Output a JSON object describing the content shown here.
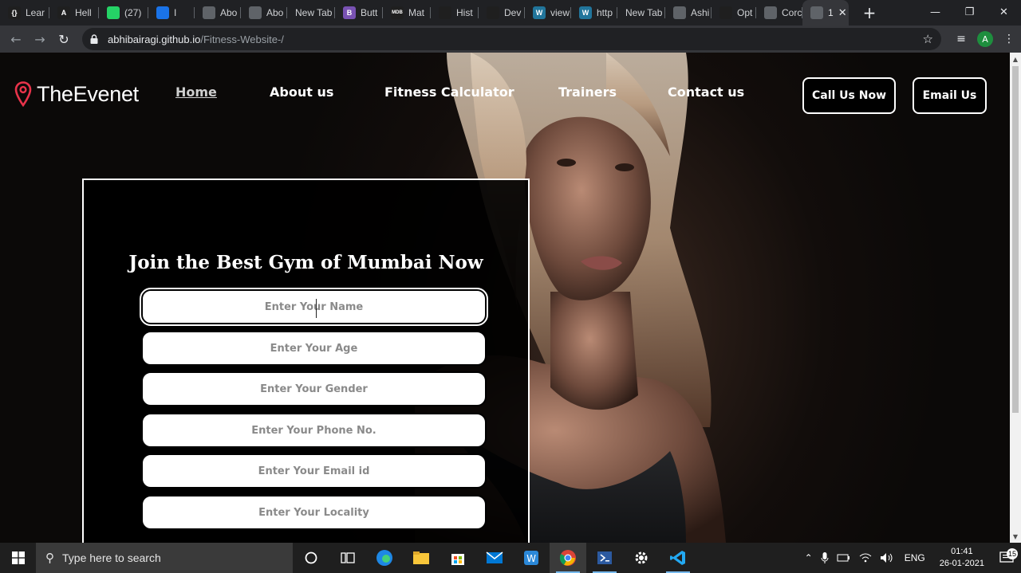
{
  "browser": {
    "tabs": [
      {
        "label": "Lear",
        "fav_color": "#1f1f1f",
        "fav_glyph": "{}",
        "icon": "code-icon"
      },
      {
        "label": "Hell",
        "fav_color": "#1f1f1f",
        "fav_glyph": "A",
        "icon": "a-logo-icon"
      },
      {
        "label": "(27)",
        "fav_color": "#25d366",
        "fav_glyph": "",
        "icon": "whatsapp-icon"
      },
      {
        "label": "I",
        "fav_color": "#1a73e8",
        "fav_glyph": "",
        "icon": "meet-icon"
      },
      {
        "label": "Abo",
        "fav_color": "#5f6368",
        "fav_glyph": "",
        "icon": "globe-icon"
      },
      {
        "label": "Abo",
        "fav_color": "#5f6368",
        "fav_glyph": "",
        "icon": "globe-icon"
      },
      {
        "label": "New Tab",
        "fav_color": "",
        "fav_glyph": "",
        "icon": ""
      },
      {
        "label": "Butt",
        "fav_color": "#7952b3",
        "fav_glyph": "B",
        "icon": "bootstrap-icon"
      },
      {
        "label": "Mat",
        "fav_color": "#1f1f1f",
        "fav_glyph": "MDB",
        "icon": "mdb-icon"
      },
      {
        "label": "Hist",
        "fav_color": "#1f1f1f",
        "fav_glyph": "",
        "icon": "history-icon"
      },
      {
        "label": "Dev",
        "fav_color": "#1f1f1f",
        "fav_glyph": "",
        "icon": "heart-icon"
      },
      {
        "label": "view",
        "fav_color": "#21759b",
        "fav_glyph": "W",
        "icon": "wordpress-icon"
      },
      {
        "label": "http",
        "fav_color": "#21759b",
        "fav_glyph": "W",
        "icon": "wordpress-icon"
      },
      {
        "label": "New Tab",
        "fav_color": "",
        "fav_glyph": "",
        "icon": ""
      },
      {
        "label": "Ashi",
        "fav_color": "#5f6368",
        "fav_glyph": "",
        "icon": "globe-icon"
      },
      {
        "label": "Opt",
        "fav_color": "#1f1f1f",
        "fav_glyph": "",
        "icon": "github-icon"
      },
      {
        "label": "Corc",
        "fav_color": "#5f6368",
        "fav_glyph": "",
        "icon": "globe-icon"
      },
      {
        "label": "1",
        "fav_color": "#5f6368",
        "fav_glyph": "",
        "icon": "globe-icon",
        "active": true
      }
    ],
    "url_host": "abhibairagi.github.io",
    "url_path": "/Fitness-Website-/",
    "profile_initial": "A"
  },
  "site": {
    "brand": "TheEvenet",
    "nav": {
      "home": "Home",
      "about": "About us",
      "calculator": "Fitness Calculator",
      "trainers": "Trainers",
      "contact": "Contact us"
    },
    "buttons": {
      "call": "Call Us Now",
      "email": "Email Us"
    },
    "accent_color": "#e8334a",
    "form": {
      "title": "Join the Best Gym of Mumbai Now",
      "fields": [
        {
          "placeholder": "Enter Your Name"
        },
        {
          "placeholder": "Enter Your Age"
        },
        {
          "placeholder": "Enter Your Gender"
        },
        {
          "placeholder": "Enter Your Phone No."
        },
        {
          "placeholder": "Enter Your Email id"
        },
        {
          "placeholder": "Enter Your Locality"
        }
      ]
    }
  },
  "taskbar": {
    "search_placeholder": "Type here to search",
    "language": "ENG",
    "time": "01:41",
    "date": "26-01-2021",
    "notification_count": "15"
  }
}
